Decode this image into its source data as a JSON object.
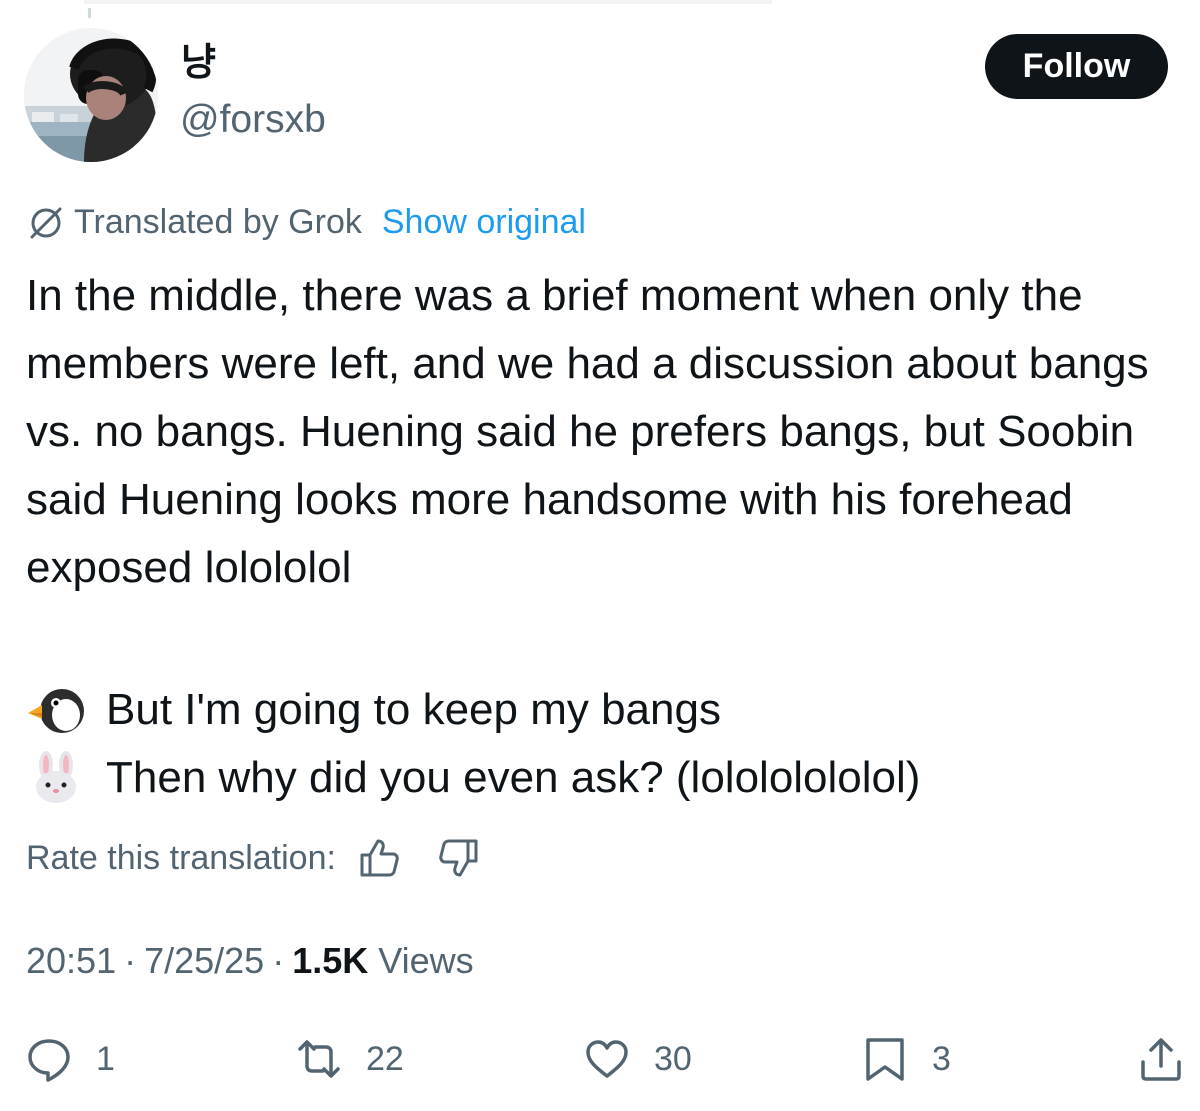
{
  "user": {
    "name": "냥",
    "handle": "@forsxb"
  },
  "follow_label": "Follow",
  "translation": {
    "label": "Translated by Grok",
    "show_original": "Show original"
  },
  "tweet": {
    "text": "In the middle, there was a brief moment when only the members were left, and we had a discussion about bangs vs. no bangs. Huening said he prefers bangs, but Soobin said Huening looks more handsome with his forehead exposed lolololol",
    "dialogue": [
      {
        "icon": "penguin-emoji-icon",
        "text": "But I'm going to keep my bangs"
      },
      {
        "icon": "rabbit-emoji-icon",
        "text": "Then why did you even ask? (lolololololol)"
      }
    ]
  },
  "rate_label": "Rate this translation:",
  "meta": {
    "time": "20:51",
    "date": "7/25/25",
    "views_count": "1.5K",
    "views_label": "Views"
  },
  "actions": {
    "replies": "1",
    "reposts": "22",
    "likes": "30",
    "bookmarks": "3"
  },
  "colors": {
    "text": "#0f1419",
    "secondary": "#536471",
    "link": "#1d9bf0",
    "button": "#0f1419"
  }
}
